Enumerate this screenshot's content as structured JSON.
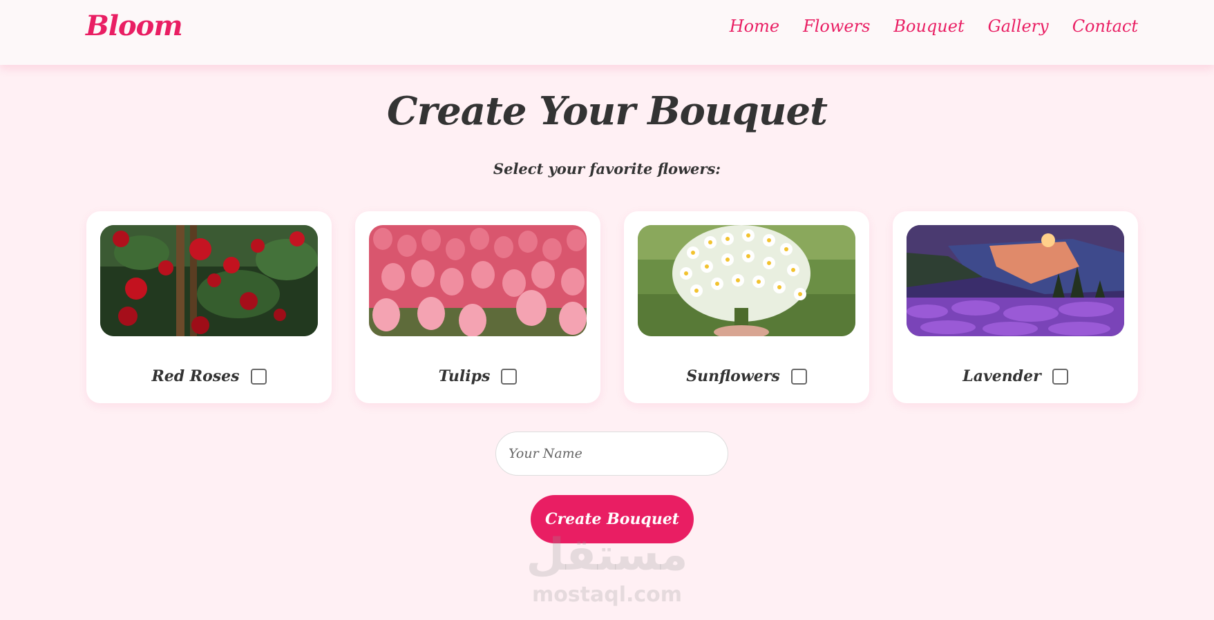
{
  "header": {
    "logo": "Bloom",
    "nav": [
      "Home",
      "Flowers",
      "Bouquet",
      "Gallery",
      "Contact"
    ]
  },
  "main": {
    "title": "Create Your Bouquet",
    "subtitle": "Select your favorite flowers:",
    "flowers": [
      {
        "label": "Red Roses",
        "checked": false,
        "image": "red-roses-photo"
      },
      {
        "label": "Tulips",
        "checked": false,
        "image": "pink-tulips-photo"
      },
      {
        "label": "Sunflowers",
        "checked": false,
        "image": "white-daisies-photo"
      },
      {
        "label": "Lavender",
        "checked": false,
        "image": "lavender-lake-sunset-photo"
      }
    ],
    "name_input": {
      "placeholder": "Your Name",
      "value": ""
    },
    "create_button": "Create Bouquet"
  },
  "watermark": {
    "arabic": "مستقل",
    "latin": "mostaql.com"
  },
  "colors": {
    "accent": "#e91e63",
    "background": "#fff0f4",
    "text": "#333333"
  }
}
